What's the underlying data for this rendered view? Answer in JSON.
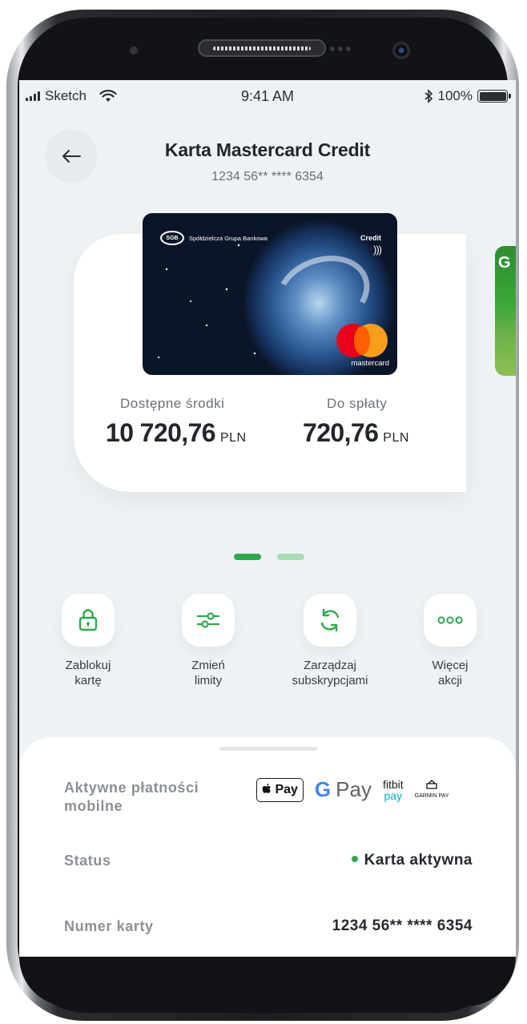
{
  "status_bar": {
    "carrier": "Sketch",
    "time": "9:41 AM",
    "battery": "100%"
  },
  "header": {
    "title": "Karta Mastercard Credit",
    "card_number": "1234 56** **** 6354"
  },
  "card": {
    "bank_logo": "SGB",
    "bank_name": "Spółdzielcza Grupa Bankowa",
    "card_type": "Credit",
    "brand": "mastercard",
    "next_card_letter": "G"
  },
  "balances": {
    "available_label": "Dostępne środki",
    "available_value": "10 720,76",
    "available_currency": "PLN",
    "due_label": "Do spłaty",
    "due_value": "720,76",
    "due_currency": "PLN"
  },
  "pager": {
    "active_color": "#2fa84f",
    "inactive_color": "#a8dcb4"
  },
  "actions": [
    {
      "label": "Zablokuj\nkartę",
      "icon": "lock-icon"
    },
    {
      "label": "Zmień\nlimity",
      "icon": "sliders-icon"
    },
    {
      "label": "Zarządzaj\nsubskrypcjami",
      "icon": "refresh-icon"
    },
    {
      "label": "Więcej\nakcji",
      "icon": "more-icon"
    }
  ],
  "details": {
    "mobile_payments_label": "Aktywne płatności\nmobilne",
    "apple_pay": "Pay",
    "google_pay_g": "G",
    "google_pay": "Pay",
    "fitbit_pay_1": "fitbit",
    "fitbit_pay_2": "pay",
    "garmin_pay": "GARMIN PAY",
    "status_label": "Status",
    "status_value": "Karta aktywna",
    "number_label": "Numer karty",
    "number_value": "1234 56** **** 6354"
  },
  "colors": {
    "accent": "#2fa84f",
    "background": "#eef2f4"
  }
}
